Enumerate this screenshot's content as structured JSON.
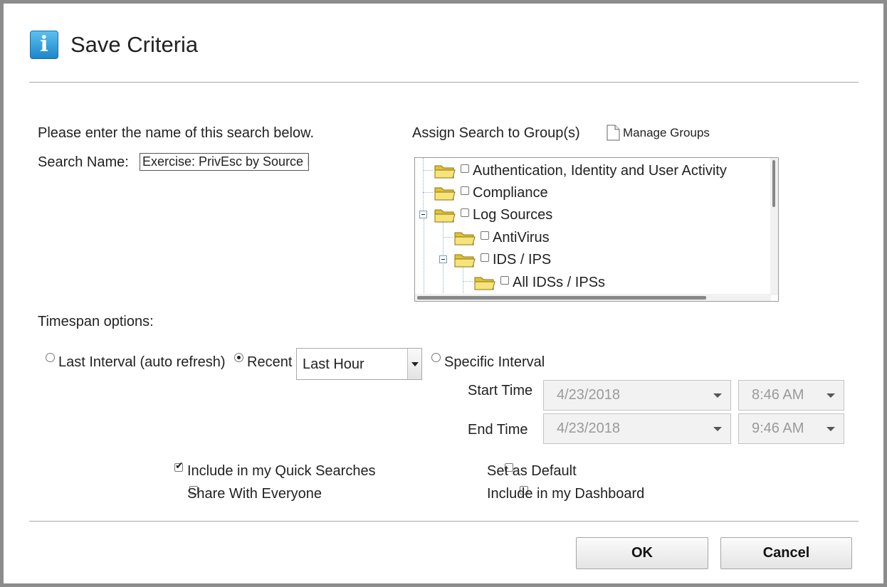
{
  "dialog": {
    "title": "Save Criteria",
    "icon": "info-icon"
  },
  "form": {
    "instruction": "Please enter the name of this search below.",
    "search_name_label": "Search Name:",
    "search_name_value": "Exercise: PrivEsc by Source I"
  },
  "groups": {
    "label": "Assign Search to Group(s)",
    "manage_label": "Manage Groups",
    "tree": [
      {
        "label": "Authentication, Identity and User Activity",
        "checked": false
      },
      {
        "label": "Compliance",
        "checked": false
      },
      {
        "label": "Log Sources",
        "checked": false,
        "expanded": true
      },
      {
        "label": "AntiVirus",
        "checked": false
      },
      {
        "label": "IDS / IPS",
        "checked": false,
        "expanded": true
      },
      {
        "label": "All IDSs / IPSs",
        "checked": false
      }
    ]
  },
  "timespan": {
    "label": "Timespan options:",
    "last_interval_label": "Last Interval (auto refresh)",
    "recent_label": "Recent",
    "recent_value": "Last Hour",
    "specific_label": "Specific Interval",
    "selected": "recent",
    "start_label": "Start Time",
    "end_label": "End Time",
    "start_date": "4/23/2018",
    "start_time": "8:46 AM",
    "end_date": "4/23/2018",
    "end_time": "9:46 AM"
  },
  "options": {
    "quick_searches": {
      "label": "Include in my Quick Searches",
      "checked": true
    },
    "share": {
      "label": "Share With Everyone",
      "checked": false
    },
    "default": {
      "label": "Set as Default",
      "checked": false
    },
    "dashboard": {
      "label": "Include in my Dashboard",
      "checked": false
    }
  },
  "buttons": {
    "ok": "OK",
    "cancel": "Cancel"
  }
}
